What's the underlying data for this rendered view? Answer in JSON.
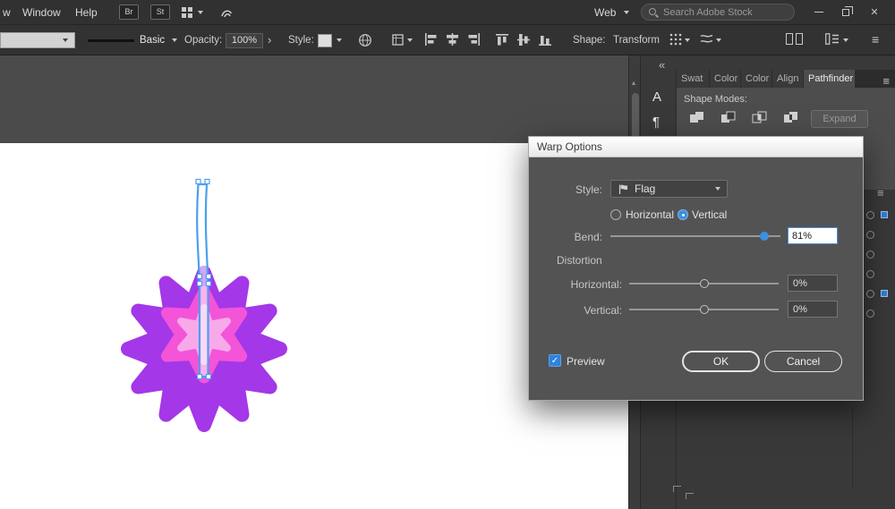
{
  "menubar": {
    "menu_items": [
      {
        "label": "w"
      },
      {
        "label": "Window"
      },
      {
        "label": "Help"
      }
    ],
    "bridge_badge": "Br",
    "stock_badge": "St",
    "workspace_label": "Web",
    "search_placeholder": "Search Adobe Stock",
    "close_glyph": "✕"
  },
  "control_bar": {
    "brush_name": "Basic",
    "opacity_label": "Opacity:",
    "opacity_value": "100%",
    "opacity_chevron": "›",
    "style_label": "Style:",
    "shape_label": "Shape:",
    "transform_label": "Transform",
    "menu_glyph": "≡"
  },
  "canvas": {
    "scroll_up_glyph": "▴",
    "artwork": {
      "star_color": "#a437e8",
      "inner_star_color": "#f354d8",
      "flower_color": "#f8a9e9",
      "path_stroke": "#4c9fef",
      "anchor_fill": "#ffffff"
    }
  },
  "right_dock": {
    "collapse_glyph": "«",
    "panel_icons": [
      {
        "glyph": "A"
      },
      {
        "glyph": "¶"
      }
    ],
    "tabs": [
      {
        "label": "Swat"
      },
      {
        "label": "Color"
      },
      {
        "label": "Color"
      },
      {
        "label": "Align"
      },
      {
        "label": "Pathfinder"
      }
    ],
    "active_tab": "Pathfinder",
    "pathfinder": {
      "shape_modes_label": "Shape Modes:",
      "expand_button": "Expand",
      "menu_glyph": "≡"
    },
    "sliver_menu_glyph": "≡"
  },
  "dialog": {
    "title": "Warp Options",
    "style_label": "Style:",
    "style_value": "Flag",
    "orientation": {
      "horizontal": "Horizontal",
      "vertical": "Vertical",
      "selected": "Vertical"
    },
    "bend_label": "Bend:",
    "bend_value": "81%",
    "distortion_label": "Distortion",
    "horizontal_label": "Horizontal:",
    "horizontal_value": "0%",
    "vertical_label": "Vertical:",
    "vertical_value": "0%",
    "preview_label": "Preview",
    "preview_checked": true,
    "check_glyph": "✓",
    "ok_label": "OK",
    "cancel_label": "Cancel"
  }
}
